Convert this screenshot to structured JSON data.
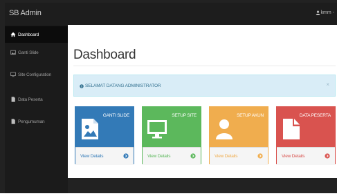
{
  "topbar": {
    "brand": "SB Admin",
    "user": "kmm -"
  },
  "sidebar": {
    "items": [
      {
        "label": "Dashboard",
        "icon": "home-icon",
        "active": true
      },
      {
        "label": "Ganti Slide",
        "icon": "image-icon",
        "active": false
      },
      {
        "label": "Site Configuration",
        "icon": "monitor-icon",
        "active": false
      },
      {
        "label": "Data Peserta",
        "icon": "document-icon",
        "active": false
      },
      {
        "label": "Pengumuman",
        "icon": "document-icon",
        "active": false
      }
    ]
  },
  "main": {
    "title": "Dashboard",
    "alert": {
      "text": "SELAMAT DATANG ADMINISTRATOR",
      "close": "×",
      "icon": "info-icon"
    },
    "panels": [
      {
        "title": "GANTI SLIDE",
        "link": "View Details",
        "color": "#337ab7",
        "icon": "image-icon"
      },
      {
        "title": "SETUP SITE",
        "link": "View Details",
        "color": "#5cb85c",
        "icon": "monitor-icon"
      },
      {
        "title": "SETUP AKUN",
        "link": "View Details",
        "color": "#f0ad4e",
        "icon": "user-icon"
      },
      {
        "title": "DATA PESERTA",
        "link": "View Details",
        "color": "#d9534f",
        "icon": "document-icon"
      }
    ]
  },
  "colors": {
    "primary": "#337ab7",
    "success": "#5cb85c",
    "warning": "#f0ad4e",
    "danger": "#d9534f",
    "info_bg": "#d9edf7",
    "sidebar": "#1b1b1b"
  }
}
